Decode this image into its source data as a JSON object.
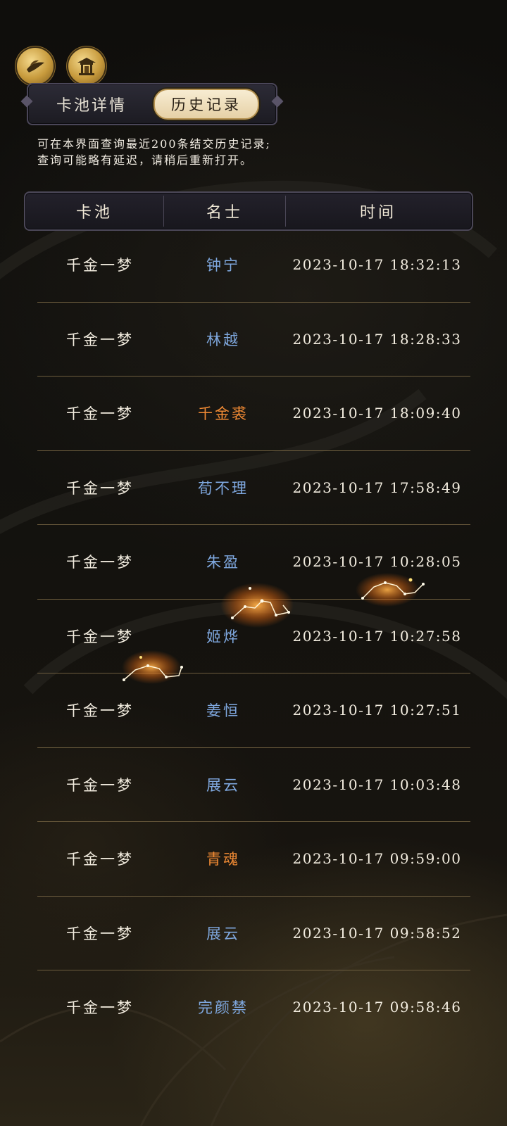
{
  "colors": {
    "name_blue": "#7fa8df",
    "name_orange": "#f08a34",
    "divider": "#6d5d3e",
    "gold": "#c79a3c"
  },
  "top_icons": [
    {
      "name": "lotus-hand-icon"
    },
    {
      "name": "pavilion-icon"
    }
  ],
  "tabs": {
    "inactive_label": "卡池详情",
    "active_label": "历史记录"
  },
  "notice": {
    "line1": "可在本界面查询最近200条结交历史记录;",
    "line2": "查询可能略有延迟，请稍后重新打开。"
  },
  "table": {
    "headers": [
      "卡池",
      "名士",
      "时间"
    ],
    "rows": [
      {
        "pool": "千金一梦",
        "name": "钟宁",
        "time": "2023-10-17 18:32:13",
        "rarity": "blue"
      },
      {
        "pool": "千金一梦",
        "name": "林越",
        "time": "2023-10-17 18:28:33",
        "rarity": "blue"
      },
      {
        "pool": "千金一梦",
        "name": "千金裘",
        "time": "2023-10-17 18:09:40",
        "rarity": "orange"
      },
      {
        "pool": "千金一梦",
        "name": "荀不理",
        "time": "2023-10-17 17:58:49",
        "rarity": "blue"
      },
      {
        "pool": "千金一梦",
        "name": "朱盈",
        "time": "2023-10-17 10:28:05",
        "rarity": "blue"
      },
      {
        "pool": "千金一梦",
        "name": "姬烨",
        "time": "2023-10-17 10:27:58",
        "rarity": "blue"
      },
      {
        "pool": "千金一梦",
        "name": "姜恒",
        "time": "2023-10-17 10:27:51",
        "rarity": "blue"
      },
      {
        "pool": "千金一梦",
        "name": "展云",
        "time": "2023-10-17 10:03:48",
        "rarity": "blue"
      },
      {
        "pool": "千金一梦",
        "name": "青魂",
        "time": "2023-10-17 09:59:00",
        "rarity": "orange"
      },
      {
        "pool": "千金一梦",
        "name": "展云",
        "time": "2023-10-17 09:58:52",
        "rarity": "blue"
      },
      {
        "pool": "千金一梦",
        "name": "完颜禁",
        "time": "2023-10-17 09:58:46",
        "rarity": "blue"
      }
    ]
  }
}
